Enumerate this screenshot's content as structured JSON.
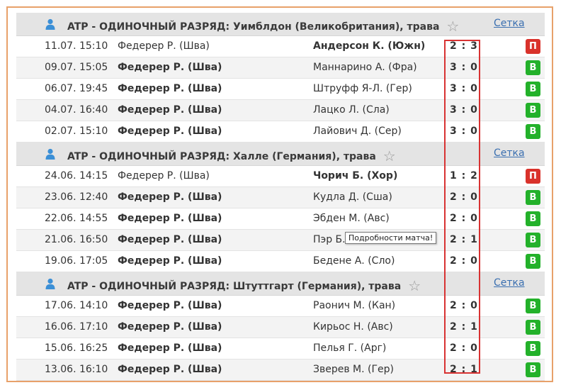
{
  "colors": {
    "accent_link": "#3a6fb0",
    "win": "#23b12a",
    "loss": "#d9322b",
    "highlight_border": "#d83232",
    "frame_border": "#e8a16a"
  },
  "icons": {
    "league_icon": "person-icon",
    "favorite_icon": "star-icon"
  },
  "tooltip": "Подробности матча!",
  "leagues": [
    {
      "title": "ATP - ОДИНОЧНЫЙ РАЗРЯД: Уимблдон (Великобритания), трава",
      "draw_link": "Сетка",
      "matches": [
        {
          "date": "11.07. 15:10",
          "home": "Федерер Р. (Шва)",
          "away": "Андерсон К. (Южн)",
          "score": "2 : 3",
          "result": "П",
          "winner": "away"
        },
        {
          "date": "09.07. 15:05",
          "home": "Федерер Р. (Шва)",
          "away": "Маннарино А. (Фра)",
          "score": "3 : 0",
          "result": "В",
          "winner": "home"
        },
        {
          "date": "06.07. 19:45",
          "home": "Федерер Р. (Шва)",
          "away": "Штруфф Я-Л. (Гер)",
          "score": "3 : 0",
          "result": "В",
          "winner": "home"
        },
        {
          "date": "04.07. 16:40",
          "home": "Федерер Р. (Шва)",
          "away": "Лацко Л. (Сла)",
          "score": "3 : 0",
          "result": "В",
          "winner": "home"
        },
        {
          "date": "02.07. 15:10",
          "home": "Федерер Р. (Шва)",
          "away": "Лайович Д. (Сер)",
          "score": "3 : 0",
          "result": "В",
          "winner": "home"
        }
      ]
    },
    {
      "title": "ATP - ОДИНОЧНЫЙ РАЗРЯД: Халле (Германия), трава",
      "draw_link": "Сетка",
      "matches": [
        {
          "date": "24.06. 14:15",
          "home": "Федерер Р. (Шва)",
          "away": "Чорич Б. (Хор)",
          "score": "1 : 2",
          "result": "П",
          "winner": "away"
        },
        {
          "date": "23.06. 12:40",
          "home": "Федерер Р. (Шва)",
          "away": "Кудла Д. (Сша)",
          "score": "2 : 0",
          "result": "В",
          "winner": "home"
        },
        {
          "date": "22.06. 14:55",
          "home": "Федерер Р. (Шва)",
          "away": "Эбден М. (Авс)",
          "score": "2 : 0",
          "result": "В",
          "winner": "home"
        },
        {
          "date": "21.06. 16:50",
          "home": "Федерер Р. (Шва)",
          "away": "Пэр Б.",
          "score": "2 : 1",
          "result": "В",
          "winner": "home"
        },
        {
          "date": "19.06. 17:05",
          "home": "Федерер Р. (Шва)",
          "away": "Бедене А. (Сло)",
          "score": "2 : 0",
          "result": "В",
          "winner": "home"
        }
      ]
    },
    {
      "title": "ATP - ОДИНОЧНЫЙ РАЗРЯД: Штуттгарт (Германия), трава",
      "draw_link": "Сетка",
      "matches": [
        {
          "date": "17.06. 14:10",
          "home": "Федерер Р. (Шва)",
          "away": "Раонич М. (Кан)",
          "score": "2 : 0",
          "result": "В",
          "winner": "home"
        },
        {
          "date": "16.06. 17:10",
          "home": "Федерер Р. (Шва)",
          "away": "Кирьос Н. (Авс)",
          "score": "2 : 1",
          "result": "В",
          "winner": "home"
        },
        {
          "date": "15.06. 16:25",
          "home": "Федерер Р. (Шва)",
          "away": "Пелья Г. (Арг)",
          "score": "2 : 0",
          "result": "В",
          "winner": "home"
        },
        {
          "date": "13.06. 16:10",
          "home": "Федерер Р. (Шва)",
          "away": "Зверев М. (Гер)",
          "score": "2 : 1",
          "result": "В",
          "winner": "home"
        }
      ]
    }
  ]
}
